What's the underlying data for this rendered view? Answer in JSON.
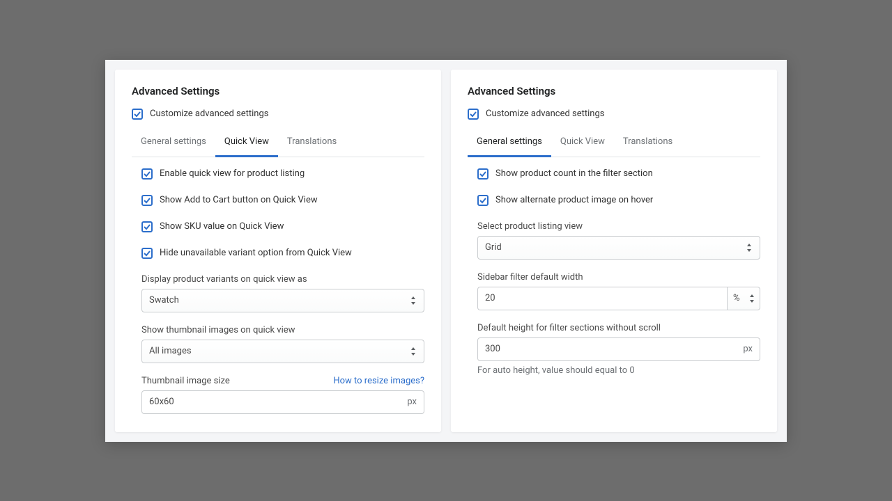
{
  "left": {
    "title": "Advanced Settings",
    "customize_label": "Customize advanced settings",
    "tabs": {
      "general": "General settings",
      "quick": "Quick View",
      "translations": "Translations"
    },
    "checks": {
      "enable_qv": "Enable quick view for product listing",
      "show_atc": "Show Add to Cart button on Quick View",
      "show_sku": "Show SKU value on Quick View",
      "hide_unavail": "Hide unavailable variant option from Quick View"
    },
    "variant_label": "Display product variants on quick view as",
    "variant_value": "Swatch",
    "thumb_mode_label": "Show thumbnail images on quick view",
    "thumb_mode_value": "All images",
    "thumb_size_label": "Thumbnail image size",
    "thumb_size_link": "How to resize images?",
    "thumb_size_value": "60x60",
    "thumb_size_suffix": "px"
  },
  "right": {
    "title": "Advanced Settings",
    "customize_label": "Customize advanced settings",
    "tabs": {
      "general": "General settings",
      "quick": "Quick View",
      "translations": "Translations"
    },
    "checks": {
      "show_count": "Show product count in the filter section",
      "alt_image": "Show alternate product image on hover"
    },
    "view_label": "Select product listing view",
    "view_value": "Grid",
    "width_label": "Sidebar filter default width",
    "width_value": "20",
    "width_unit": "%",
    "height_label": "Default height for filter sections without scroll",
    "height_value": "300",
    "height_suffix": "px",
    "height_help": "For auto height, value should equal to 0"
  }
}
